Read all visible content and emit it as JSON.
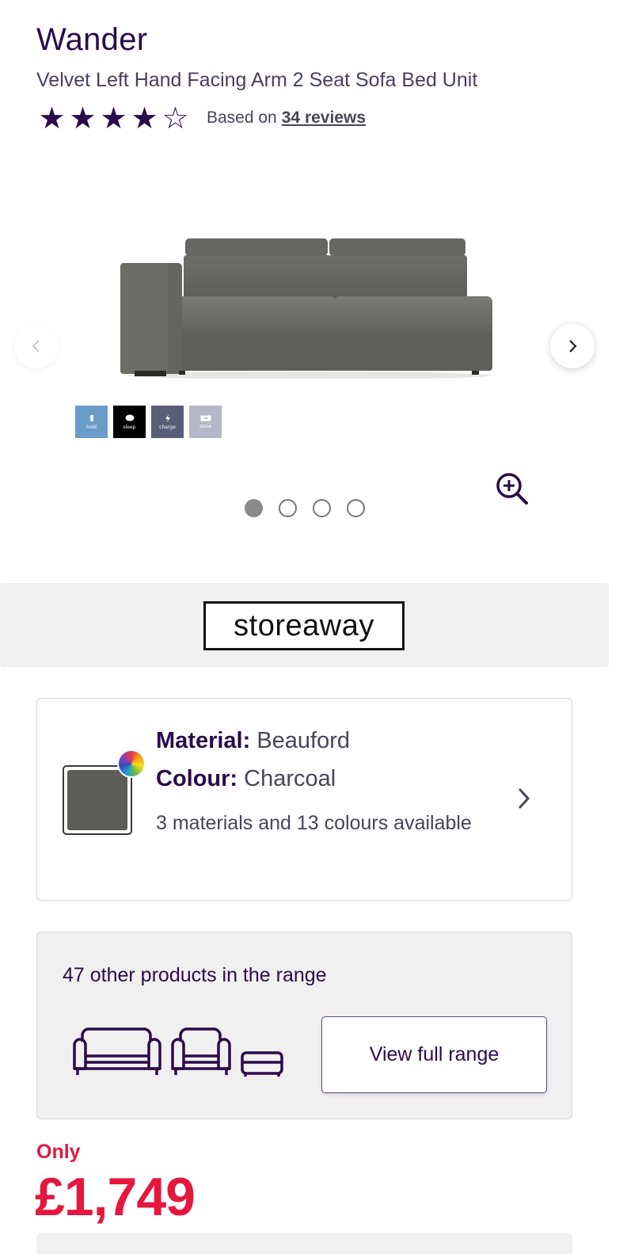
{
  "product": {
    "name": "Wander",
    "description": "Velvet Left Hand Facing Arm 2 Seat Sofa Bed Unit",
    "rating": 4,
    "rating_max": 5,
    "rating_prefix": "Based on",
    "reviews_link": "34 reviews"
  },
  "gallery": {
    "slide_count": 4,
    "active_slide": 1,
    "feature_icons": [
      {
        "label": "hold",
        "color": "#6a9cc9"
      },
      {
        "label": "sleep",
        "color": "#000000"
      },
      {
        "label": "charge",
        "color": "#5a5d78"
      },
      {
        "label": "store",
        "color": "#b3b7c7"
      }
    ]
  },
  "brand": {
    "logo_text": "storeaway"
  },
  "material": {
    "material_label": "Material:",
    "material_value": "Beauford",
    "colour_label": "Colour:",
    "colour_value": "Charcoal",
    "availability": "3 materials and 13 colours available",
    "swatch_color": "#5c5c58"
  },
  "range": {
    "text": "47 other products in the range",
    "button_label": "View full range"
  },
  "price": {
    "prefix": "Only",
    "value": "£1,749",
    "color": "#e5173f"
  },
  "colors": {
    "primary": "#2c0a4a",
    "muted_text": "#4a4358",
    "panel": "#f0f0f0"
  }
}
